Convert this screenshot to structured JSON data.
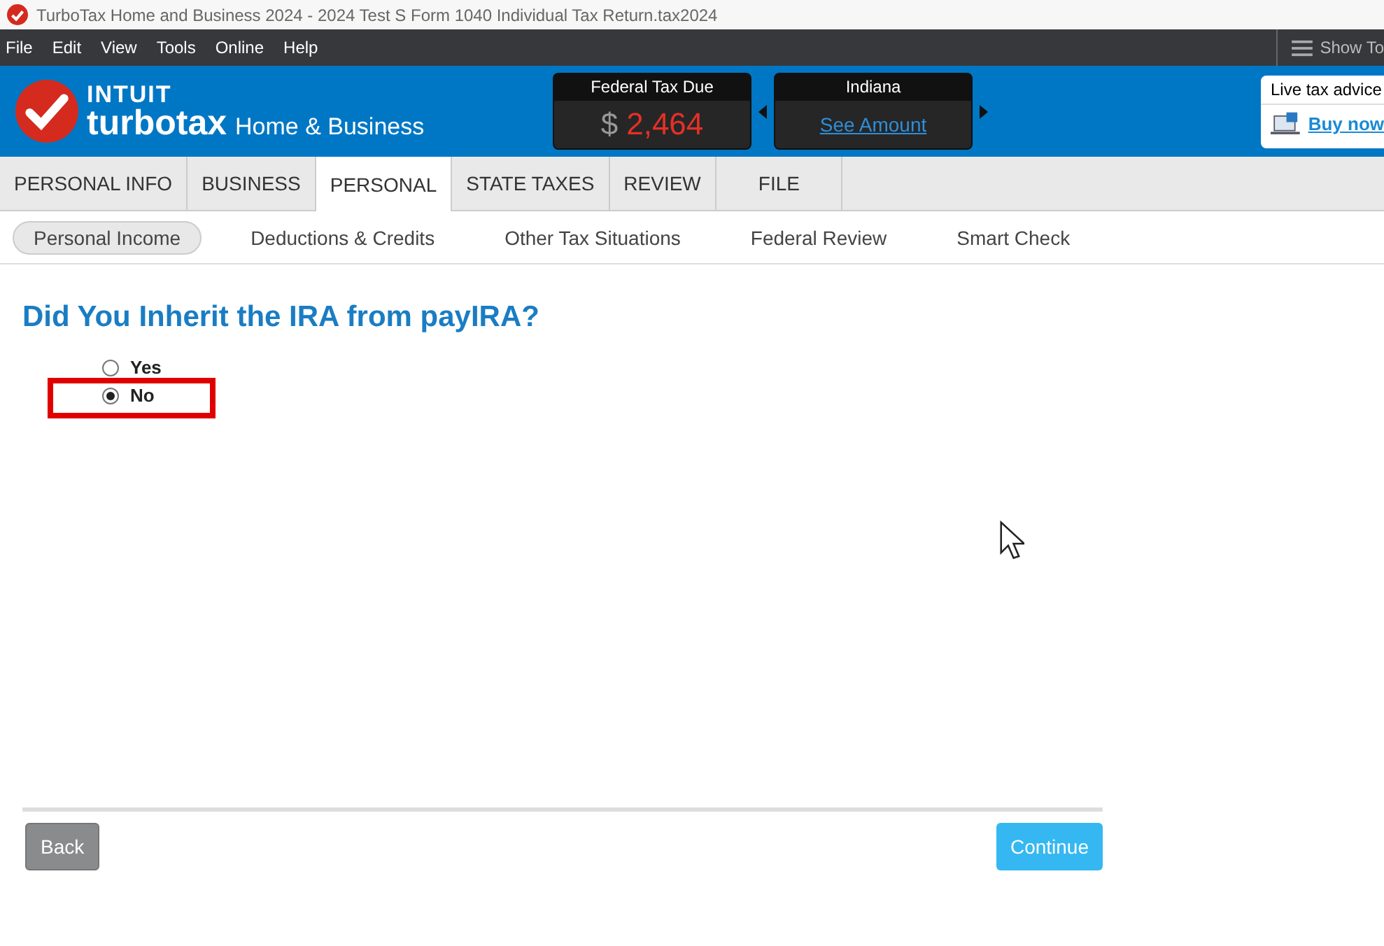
{
  "window": {
    "title": "TurboTax Home and Business 2024 - 2024 Test S Form 1040  Individual Tax Return.tax2024"
  },
  "menu": [
    "File",
    "Edit",
    "View",
    "Tools",
    "Online",
    "Help"
  ],
  "show_tools": "Show To",
  "brand": {
    "company": "INTUIT",
    "product": "turbotax",
    "edition": "Home & Business"
  },
  "federal": {
    "label": "Federal Tax Due",
    "currency": "$",
    "amount": "2,464"
  },
  "state": {
    "label": "Indiana",
    "link": "See Amount"
  },
  "advice": {
    "label": "Live tax advice",
    "link": "Buy now"
  },
  "tabs": [
    {
      "label": "PERSONAL INFO",
      "selected": false
    },
    {
      "label": "BUSINESS",
      "selected": false
    },
    {
      "label": "PERSONAL",
      "selected": true
    },
    {
      "label": "STATE TAXES",
      "selected": false
    },
    {
      "label": "REVIEW",
      "selected": false
    },
    {
      "label": "FILE",
      "selected": false
    }
  ],
  "subtabs": [
    {
      "label": "Personal Income",
      "selected": true
    },
    {
      "label": "Deductions & Credits",
      "selected": false
    },
    {
      "label": "Other Tax Situations",
      "selected": false
    },
    {
      "label": "Federal Review",
      "selected": false
    },
    {
      "label": "Smart Check",
      "selected": false
    }
  ],
  "question": "Did You Inherit the IRA from payIRA?",
  "options": [
    {
      "label": "Yes",
      "selected": false,
      "highlighted": false
    },
    {
      "label": "No",
      "selected": true,
      "highlighted": true
    }
  ],
  "buttons": {
    "back": "Back",
    "continue": "Continue"
  }
}
